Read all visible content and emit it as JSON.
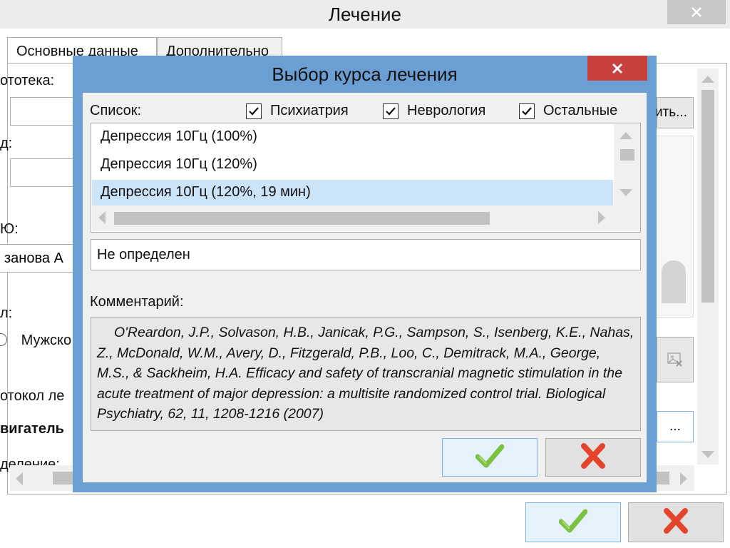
{
  "main": {
    "title": "Лечение",
    "tabs": [
      {
        "label": "Основные данные"
      },
      {
        "label": "Дополнительно"
      }
    ],
    "fields": {
      "photo_label": "ототека:",
      "id_label": "д:",
      "fio_label": "Ю:",
      "fio_value": "занова А",
      "gender_label": "л:",
      "gender_value": "Мужско",
      "protocol_label": "отокол ле",
      "protocol_value": "вигатель",
      "division_label": "деление:"
    },
    "browse_button": "ить...",
    "ellipsis_button": "..."
  },
  "dialog": {
    "title": "Выбор курса лечения",
    "list_label": "Список:",
    "filters": [
      {
        "label": "Психиатрия",
        "checked": true
      },
      {
        "label": "Неврология",
        "checked": true
      },
      {
        "label": "Остальные",
        "checked": true
      }
    ],
    "courses": [
      {
        "label": "Депрессия 10Гц (100%)",
        "selected": false
      },
      {
        "label": "Депрессия 10Гц (120%)",
        "selected": false
      },
      {
        "label": "Депрессия 10Гц (120%, 19 мин)",
        "selected": true
      }
    ],
    "status_value": "Не определен",
    "comment_label": "Комментарий:",
    "comment_text": "O'Reardon, J.P., Solvason, H.B., Janicak, P.G., Sampson, S., Isenberg, K.E., Nahas, Z., McDonald, W.M., Avery, D., Fitzgerald, P.B., Loo, C., Demitrack, M.A., George, M.S., & Sackheim, H.A. Efficacy and safety of transcranial magnetic stimulation in the acute treatment of major depression: a multisite randomized control trial. Biological Psychiatry, 62, 11, 1208-1216 (2007)"
  },
  "colors": {
    "dialog_frame": "#6b9fd3",
    "close_red": "#c8413d",
    "selection": "#cce4f7",
    "ok_green": "#7cc242",
    "cancel_red": "#e3442b"
  },
  "icons": {
    "ok": "check-icon",
    "cancel": "cross-icon",
    "close": "close-icon"
  }
}
